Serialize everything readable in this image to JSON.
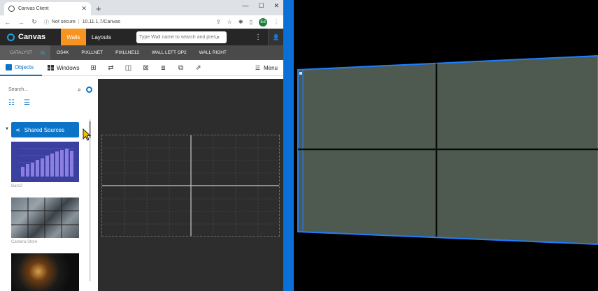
{
  "browser": {
    "tab_title": "Canvas Client",
    "new_tab": "+",
    "window_controls": [
      "—",
      "☐",
      "✕"
    ],
    "address_warning": "Not secure",
    "address_url": "10.11.1.7/Canvas",
    "profile_initials": "Ed"
  },
  "app": {
    "brand": "Canvas",
    "nav_walls": "Walls",
    "nav_layouts": "Layouts",
    "search_placeholder": "Type Wall name to search and pres",
    "walls": [
      "CATALYST",
      "OS4K",
      "PIXLLNET",
      "PIXLLNE12",
      "WALL LEFT OP2",
      "WALL RIGHT"
    ],
    "tab_objects": "Objects",
    "tab_windows": "Windows",
    "menu_label": "Menu"
  },
  "left_panel": {
    "search_placeholder": "Search...",
    "shared_sources_label": "Shared Sources",
    "sources": [
      {
        "caption": "Bars2"
      },
      {
        "caption": "Camera Store"
      },
      {
        "caption": ""
      }
    ]
  },
  "colors": {
    "accent_blue": "#0b74c8",
    "walls_orange": "#f7931e",
    "header_dark": "#262626",
    "wall_panel": "#4e5a4f",
    "wall_border": "#1e7fff"
  }
}
